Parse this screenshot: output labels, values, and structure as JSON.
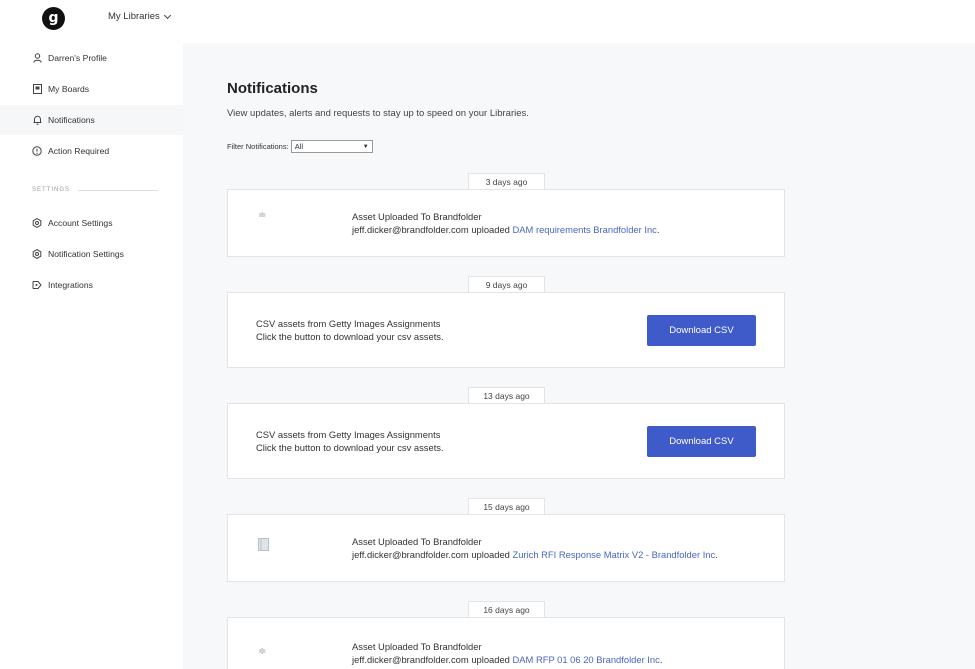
{
  "header": {
    "logo_letter": "g",
    "library_menu": "My Libraries"
  },
  "sidebar": {
    "items": [
      {
        "label": "Darren's Profile",
        "icon": "person-icon"
      },
      {
        "label": "My Boards",
        "icon": "board-icon"
      },
      {
        "label": "Notifications",
        "icon": "bell-icon",
        "active": true
      },
      {
        "label": "Action Required",
        "icon": "alert-icon"
      }
    ],
    "settings_heading": "SETTINGS",
    "settings_items": [
      {
        "label": "Account Settings",
        "icon": "gear-icon"
      },
      {
        "label": "Notification Settings",
        "icon": "gear-icon"
      },
      {
        "label": "Integrations",
        "icon": "plug-icon"
      }
    ]
  },
  "main": {
    "title": "Notifications",
    "subtitle": "View updates, alerts and requests to stay up to speed on your Libraries.",
    "filter_label": "Filter Notifications:",
    "filter_value": "All",
    "notifications": [
      {
        "date": "3 days ago",
        "type": "asset",
        "title": "Asset Uploaded To Brandfolder",
        "user": "jeff.dicker@brandfolder.com",
        "action": "uploaded",
        "link": "DAM requirements Brandfolder Inc",
        "suffix": "."
      },
      {
        "date": "9 days ago",
        "type": "csv",
        "title": "CSV assets from Getty Images Assignments",
        "body": "Click the button to download your csv assets.",
        "button": "Download CSV"
      },
      {
        "date": "13 days ago",
        "type": "csv",
        "title": "CSV assets from Getty Images Assignments",
        "body": "Click the button to download your csv assets.",
        "button": "Download CSV"
      },
      {
        "date": "15 days ago",
        "type": "asset",
        "title": "Asset Uploaded To Brandfolder",
        "user": "jeff.dicker@brandfolder.com",
        "action": "uploaded",
        "link": "Zurich RFI Response Matrix V2 - Brandfolder Inc",
        "suffix": "."
      },
      {
        "date": "16 days ago",
        "type": "asset",
        "title": "Asset Uploaded To Brandfolder",
        "user": "jeff.dicker@brandfolder.com",
        "action": "uploaded",
        "link": "DAM RFP 01 06 20 Brandfolder Inc",
        "suffix": "."
      }
    ]
  },
  "colors": {
    "accent": "#3f5bc9",
    "link": "#4a65c5",
    "page_bg": "#f7f8fa"
  }
}
